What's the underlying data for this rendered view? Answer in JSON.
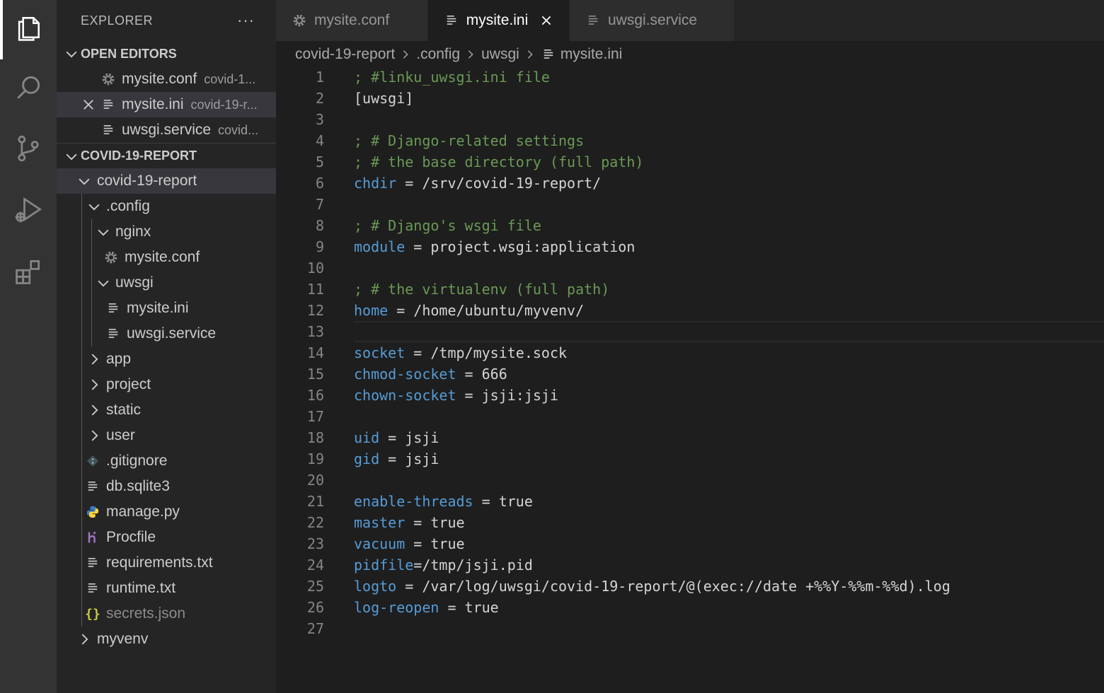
{
  "activity_bar": {
    "items": [
      {
        "name": "explorer",
        "icon": "files-icon"
      },
      {
        "name": "search",
        "icon": "search-icon"
      },
      {
        "name": "source-control",
        "icon": "source-control-icon"
      },
      {
        "name": "run-debug",
        "icon": "run-debug-icon"
      },
      {
        "name": "extensions",
        "icon": "extensions-icon"
      }
    ]
  },
  "sidebar": {
    "title": "EXPLORER",
    "more_label": "···",
    "open_editors": {
      "label": "OPEN EDITORS",
      "items": [
        {
          "name": "mysite.conf",
          "desc": "covid-1..."
        },
        {
          "name": "mysite.ini",
          "desc": "covid-19-r..."
        },
        {
          "name": "uwsgi.service",
          "desc": "covid..."
        }
      ]
    },
    "project": {
      "label": "COVID-19-REPORT",
      "tree": [
        {
          "label": "covid-19-report"
        },
        {
          "label": ".config"
        },
        {
          "label": "nginx"
        },
        {
          "label": "mysite.conf"
        },
        {
          "label": "uwsgi"
        },
        {
          "label": "mysite.ini"
        },
        {
          "label": "uwsgi.service"
        },
        {
          "label": "app"
        },
        {
          "label": "project"
        },
        {
          "label": "static"
        },
        {
          "label": "user"
        },
        {
          "label": ".gitignore"
        },
        {
          "label": "db.sqlite3"
        },
        {
          "label": "manage.py"
        },
        {
          "label": "Procfile"
        },
        {
          "label": "requirements.txt"
        },
        {
          "label": "runtime.txt"
        },
        {
          "label": "secrets.json"
        },
        {
          "label": "myvenv"
        }
      ]
    }
  },
  "tabs": [
    {
      "label": "mysite.conf",
      "icon": "gear-icon",
      "active": false
    },
    {
      "label": "mysite.ini",
      "icon": "lines-icon",
      "active": true
    },
    {
      "label": "uwsgi.service",
      "icon": "lines-icon",
      "active": false
    }
  ],
  "breadcrumb": [
    "covid-19-report",
    ".config",
    "uwsgi",
    "mysite.ini"
  ],
  "editor": {
    "current_line": 13,
    "lines": [
      {
        "n": "1",
        "com": "; #linku_uwsgi.ini file"
      },
      {
        "n": "2",
        "txt": "[uwsgi]"
      },
      {
        "n": "3"
      },
      {
        "n": "4",
        "com": "; # Django-related settings"
      },
      {
        "n": "5",
        "com": "; # the base directory (full path)"
      },
      {
        "n": "6",
        "key": "chdir",
        "txt": " = /srv/covid-19-report/"
      },
      {
        "n": "7"
      },
      {
        "n": "8",
        "com": "; # Django's wsgi file"
      },
      {
        "n": "9",
        "key": "module",
        "txt": " = project.wsgi:application"
      },
      {
        "n": "10"
      },
      {
        "n": "11",
        "com": "; # the virtualenv (full path)"
      },
      {
        "n": "12",
        "key": "home",
        "txt": " = /home/ubuntu/myvenv/"
      },
      {
        "n": "13"
      },
      {
        "n": "14",
        "key": "socket",
        "txt": " = /tmp/mysite.sock"
      },
      {
        "n": "15",
        "key": "chmod-socket",
        "txt": " = 666"
      },
      {
        "n": "16",
        "key": "chown-socket",
        "txt": " = jsji:jsji"
      },
      {
        "n": "17"
      },
      {
        "n": "18",
        "key": "uid",
        "txt": " = jsji"
      },
      {
        "n": "19",
        "key": "gid",
        "txt": " = jsji"
      },
      {
        "n": "20"
      },
      {
        "n": "21",
        "key": "enable-threads",
        "txt": " = true"
      },
      {
        "n": "22",
        "key": "master",
        "txt": " = true"
      },
      {
        "n": "23",
        "key": "vacuum",
        "txt": " = true"
      },
      {
        "n": "24",
        "key": "pidfile",
        "txt": "=/tmp/jsji.pid"
      },
      {
        "n": "25",
        "key": "logto",
        "txt": " = /var/log/uwsgi/covid-19-report/@(exec://date +%%Y-%%m-%%d).log"
      },
      {
        "n": "26",
        "key": "log-reopen",
        "txt": " = true"
      },
      {
        "n": "27"
      }
    ]
  },
  "colors": {
    "comment": "#6a9955",
    "key": "#569cd6",
    "text": "#d4d4d4",
    "line_number": "#858585"
  }
}
